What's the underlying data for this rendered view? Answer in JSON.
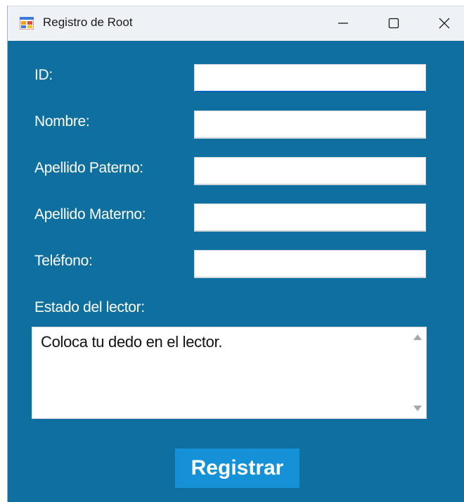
{
  "window": {
    "title": "Registro de Root",
    "icon": "app-form-icon",
    "controls": {
      "minimize": "minimize-icon",
      "maximize": "maximize-icon",
      "close": "close-icon"
    },
    "background_color": "#0f6f9f"
  },
  "form": {
    "fields": [
      {
        "label": "ID:",
        "value": ""
      },
      {
        "label": "Nombre:",
        "value": ""
      },
      {
        "label": "Apellido Paterno:",
        "value": ""
      },
      {
        "label": "Apellido Materno:",
        "value": ""
      },
      {
        "label": "Teléfono:",
        "value": ""
      }
    ],
    "status_label": "Estado del lector:",
    "status_text": "Coloca tu dedo en el lector.",
    "submit_label": "Registrar",
    "submit_color": "#1591d8"
  }
}
